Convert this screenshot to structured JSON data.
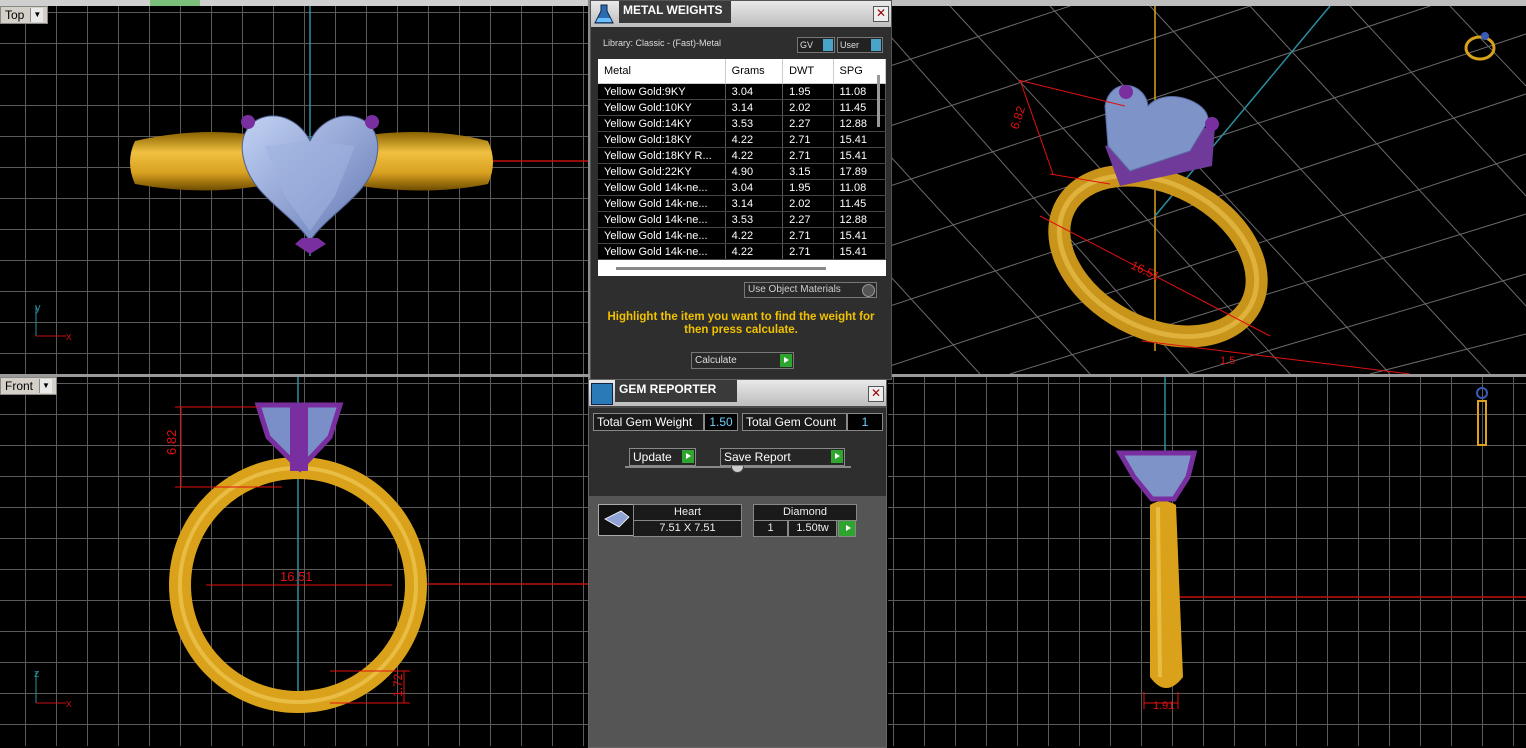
{
  "viewports": {
    "top": {
      "label": "Top",
      "axis_y": "y",
      "axis_x": "x"
    },
    "front": {
      "label": "Front",
      "axis_y": "z",
      "axis_x": "x"
    },
    "front_dims": {
      "height": "6.82",
      "width": "16.51",
      "thickness": "1.72"
    },
    "persp_dims": {
      "height": "6.82",
      "width": "16.51",
      "band": "1.5"
    },
    "right_dims": {
      "band": "1.91"
    }
  },
  "metal_weights": {
    "title": "METAL WEIGHTS",
    "library": "Library: Classic - (Fast)-Metal",
    "toggle_gv": "GV",
    "toggle_user": "User",
    "columns": [
      "Metal",
      "Grams",
      "DWT",
      "SPG"
    ],
    "rows": [
      [
        "Yellow Gold:9KY",
        "3.04",
        "1.95",
        "11.08"
      ],
      [
        "Yellow Gold:10KY",
        "3.14",
        "2.02",
        "11.45"
      ],
      [
        "Yellow Gold:14KY",
        "3.53",
        "2.27",
        "12.88"
      ],
      [
        "Yellow Gold:18KY",
        "4.22",
        "2.71",
        "15.41"
      ],
      [
        "Yellow Gold:18KY R...",
        "4.22",
        "2.71",
        "15.41"
      ],
      [
        "Yellow Gold:22KY",
        "4.90",
        "3.15",
        "17.89"
      ],
      [
        "Yellow Gold 14k-ne...",
        "3.04",
        "1.95",
        "11.08"
      ],
      [
        "Yellow Gold 14k-ne...",
        "3.14",
        "2.02",
        "11.45"
      ],
      [
        "Yellow Gold 14k-ne...",
        "3.53",
        "2.27",
        "12.88"
      ],
      [
        "Yellow Gold 14k-ne...",
        "4.22",
        "2.71",
        "15.41"
      ],
      [
        "Yellow Gold 14k-ne...",
        "4.22",
        "2.71",
        "15.41"
      ]
    ],
    "use_object_materials": "Use Object Materials",
    "instruction": "Highlight the item you want to find the weight for then press calculate.",
    "calculate": "Calculate"
  },
  "gem_reporter": {
    "title": "GEM REPORTER",
    "total_weight_label": "Total Gem Weight",
    "total_weight_value": "1.50",
    "total_count_label": "Total Gem Count",
    "total_count_value": "1",
    "update": "Update",
    "save_report": "Save Report",
    "gem": {
      "shape": "Heart",
      "size": "7.51 X 7.51",
      "type": "Diamond",
      "count": "1",
      "weight": "1.50tw"
    }
  },
  "colors": {
    "gold": "#d9a21a",
    "gem": "#8fa3d4",
    "prong": "#7a2fa0",
    "dimension": "#e01010",
    "accent": "#f2c200"
  }
}
